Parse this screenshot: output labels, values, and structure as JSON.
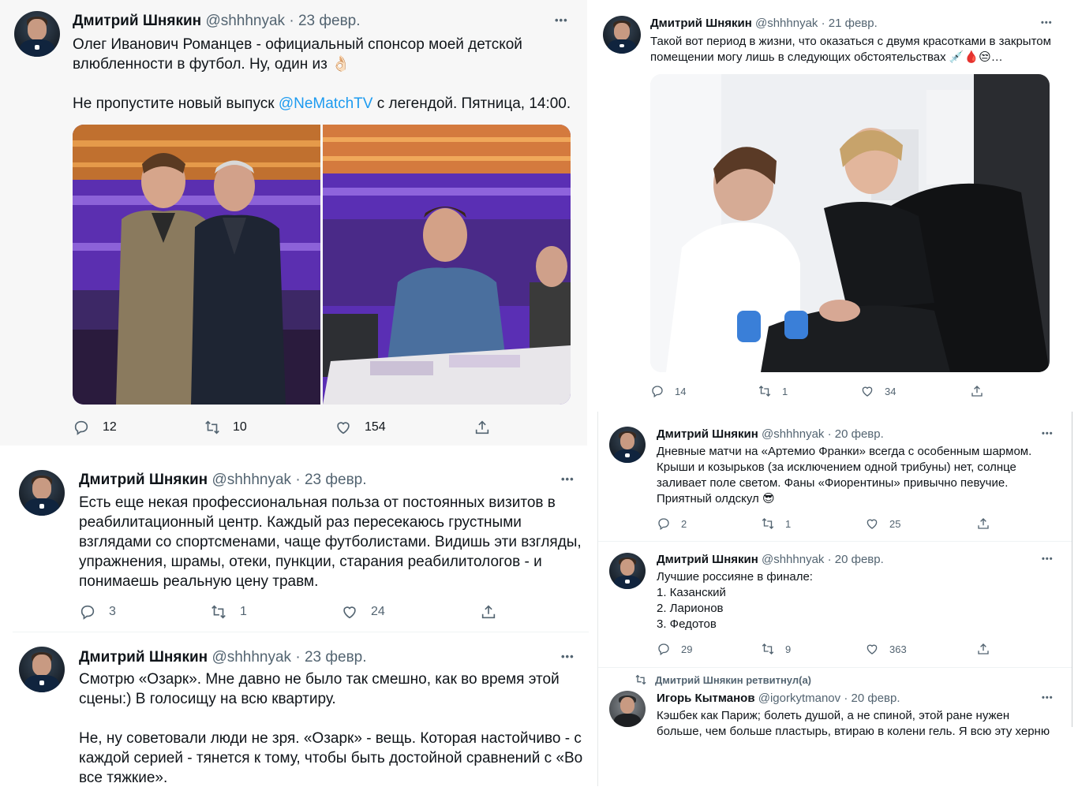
{
  "tweet1": {
    "name": "Дмитрий Шнякин",
    "handle": "@shhhnyak",
    "separator": "·",
    "date": "23 февр.",
    "more": "•••",
    "line1": "Олег Иванович Романцев - официальный спонсор моей детской",
    "line2": "влюбленности в футбол. Ну, один из 👌🏻",
    "line3_before": "Не пропустите новый выпуск ",
    "mention": "@NeMatchTV",
    "line3_after": " с легендой. Пятница, 14:00.",
    "replies": "12",
    "retweets": "10",
    "likes": "154"
  },
  "tweet2": {
    "name": "Дмитрий Шнякин",
    "handle": "@shhhnyak",
    "separator": "·",
    "date": "21 февр.",
    "more": "•••",
    "line1": "Такой вот период в жизни, что оказаться с двумя красотками в закрытом",
    "line2": "помещении могу лишь в следующих обстоятельствах 💉🩸😒…",
    "replies": "14",
    "retweets": "1",
    "likes": "34"
  },
  "tweet3": {
    "name": "Дмитрий Шнякин",
    "handle": "@shhhnyak",
    "separator": "·",
    "date": "23 февр.",
    "more": "•••",
    "lines": [
      "Есть еще некая профессиональная польза от постоянных визитов в",
      "реабилитационный центр. Каждый раз пересекаюсь грустными",
      "взглядами со спортсменами, чаще футболистами. Видишь эти взгляды,",
      "упражнения, шрамы, отеки, пункции, старания реабилитологов - и",
      "понимаешь реальную цену травм."
    ],
    "replies": "3",
    "retweets": "1",
    "likes": "24"
  },
  "tweet4": {
    "name": "Дмитрий Шнякин",
    "handle": "@shhhnyak",
    "separator": "·",
    "date": "20 февр.",
    "more": "•••",
    "lines": [
      "Дневные матчи на «Артемио Франки» всегда с особенным шармом.",
      "Крыши и козырьков (за исключением одной трибуны) нет, солнце",
      "заливает поле светом. Фаны «Фиорентины» привычно певучие.",
      "Приятный олдскул 😎"
    ],
    "replies": "2",
    "retweets": "1",
    "likes": "25"
  },
  "tweet5": {
    "name": "Дмитрий Шнякин",
    "handle": "@shhhnyak",
    "separator": "·",
    "date": "20 февр.",
    "more": "•••",
    "lines": [
      "Лучшие россияне в финале:",
      "1. Казанский",
      "2. Ларионов",
      "3. Федотов"
    ],
    "replies": "29",
    "retweets": "9",
    "likes": "363"
  },
  "tweet6": {
    "name": "Дмитрий Шнякин",
    "handle": "@shhhnyak",
    "separator": "·",
    "date": "23 февр.",
    "more": "•••",
    "lines": [
      "Смотрю «Озарк». Мне давно не было так смешно, как во время этой",
      "сцены:) В голосищу на всю квартиру.",
      "",
      "Не, ну советовали люди не зря. «Озарк» - вещь. Которая настойчиво - с",
      "каждой серией - тянется к тому, чтобы быть достойной сравнений с «Во",
      "все тяжкие»."
    ]
  },
  "tweet7": {
    "retweet_label": "Дмитрий Шнякин ретвитнул(а)",
    "name": "Игорь Кытманов",
    "handle": "@igorkytmanov",
    "separator": "·",
    "date": "20 февр.",
    "more": "•••",
    "lines": [
      "Кэшбек как Париж; болеть душой, а не спиной, этой ране нужен",
      "больше, чем больше пластырь, втираю в колени гель. Я всю эту херню"
    ]
  },
  "colors": {
    "accent": "#1d9bf0",
    "text": "#0f1419",
    "muted": "#536471",
    "shaded_bg": "#f7f7f7"
  },
  "icons": [
    "reply-icon",
    "retweet-icon",
    "like-icon",
    "share-icon",
    "more-icon"
  ]
}
